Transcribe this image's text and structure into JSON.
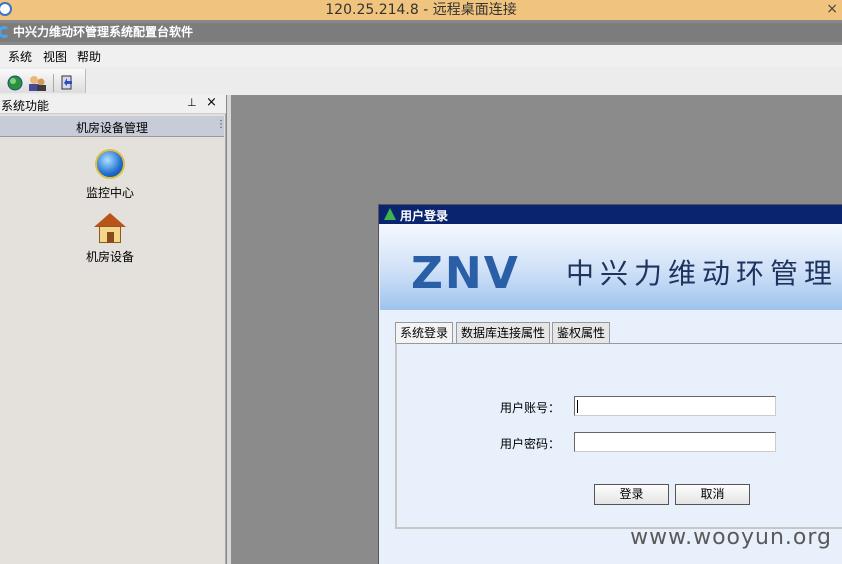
{
  "rdp": {
    "title": "120.25.214.8 - 远程桌面连接",
    "close_icon": "×"
  },
  "app": {
    "title": "中兴力维动环管理系统配置台软件"
  },
  "menu": {
    "items": [
      "系统",
      "视图",
      "帮助"
    ]
  },
  "toolbar": {
    "icons": [
      "globe-icon",
      "users-icon",
      "exit-icon"
    ]
  },
  "sidebar": {
    "panel_title": "系统功能",
    "pin_icon": "⊥",
    "close_icon": "×",
    "group_title": "机房设备管理",
    "grip_icon": "⋮",
    "items": [
      {
        "label": "监控中心",
        "icon": "globe-icon"
      },
      {
        "label": "机房设备",
        "icon": "house-icon"
      }
    ]
  },
  "dialog": {
    "title": "用户登录",
    "logo": "ZNV",
    "banner_text": "中兴力维动环管理",
    "tabs": [
      "系统登录",
      "数据库连接属性",
      "鉴权属性"
    ],
    "fields": {
      "account_label": "用户账号：",
      "account_value": "",
      "password_label": "用户密码：",
      "password_value": ""
    },
    "buttons": {
      "login": "登录",
      "cancel": "取消"
    }
  },
  "watermark": "www.wooyun.org",
  "colors": {
    "rdp_bar": "#f0c47e",
    "dialog_titlebar": "#0a2470",
    "logo": "#2a5fa8"
  }
}
